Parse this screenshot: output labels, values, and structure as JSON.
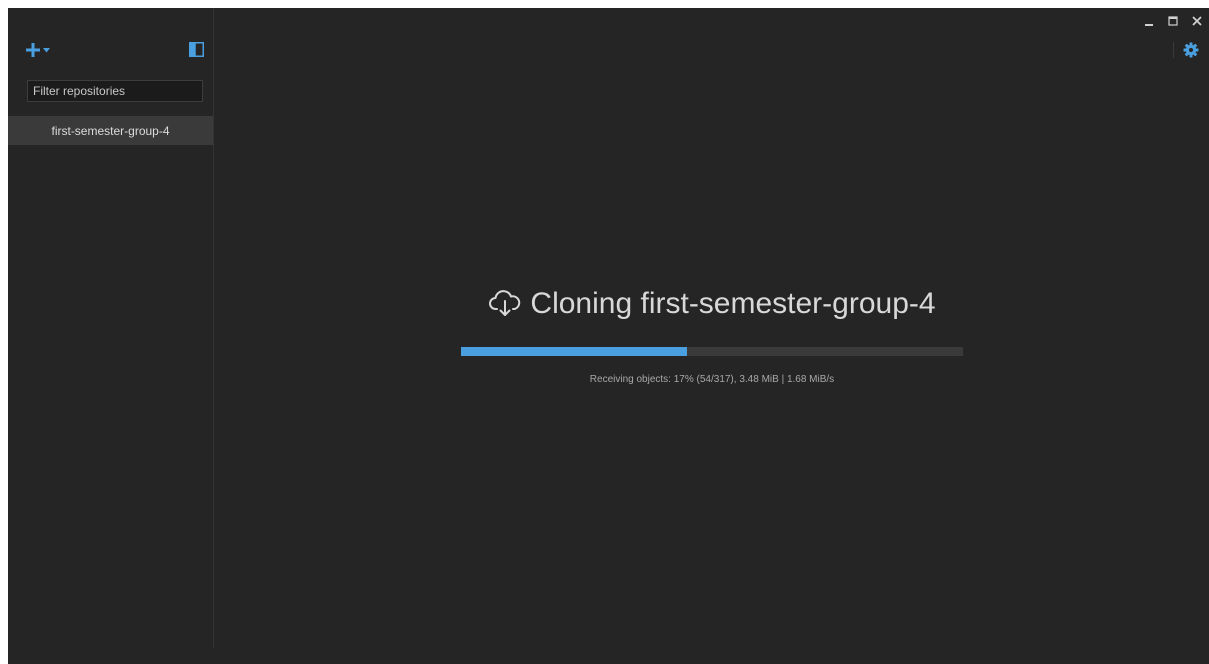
{
  "sidebar": {
    "add_icon": "plus-icon",
    "add_dropdown_icon": "caret-down-icon",
    "toggle_icon": "sidebar-panel-icon",
    "filter": {
      "placeholder": "Filter repositories",
      "value": ""
    },
    "repositories": [
      {
        "name": "first-semester-group-4",
        "selected": true
      }
    ]
  },
  "window_controls": {
    "minimize_icon": "minimize-icon",
    "maximize_icon": "maximize-icon",
    "close_icon": "close-icon",
    "settings_icon": "gear-icon"
  },
  "clone": {
    "icon": "cloud-download-icon",
    "title": "Cloning first-semester-group-4",
    "progress": 0.45,
    "status": "Receiving objects:  17% (54/317), 3.48 MiB | 1.68 MiB/s"
  },
  "colors": {
    "accent": "#4a9fe0",
    "background": "#252525",
    "sidebar_selected": "#3a3a3a",
    "progress_track": "#3a3a3a"
  }
}
